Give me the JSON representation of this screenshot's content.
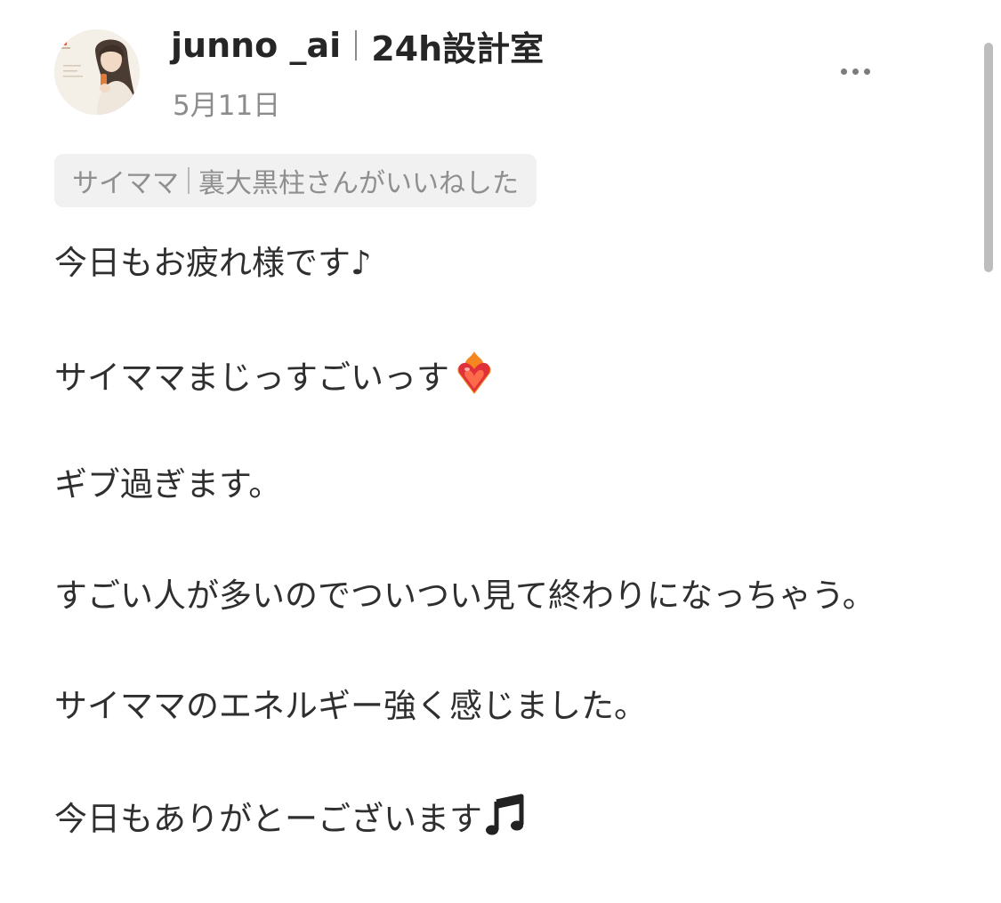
{
  "author": {
    "name": "junno _ai",
    "affiliation": "24h設計室",
    "avatar_icon": "woman-with-phone-avatar"
  },
  "post": {
    "date": "5月11日",
    "liked_by": {
      "user": "サイママ",
      "user_suffix": "裏大黒柱さん",
      "action": "がいいねした"
    },
    "lines": [
      {
        "text": "今日もお疲れ様です♪",
        "emoji": ""
      },
      {
        "text": "サイママまじっすごいっす",
        "emoji": "heart-on-fire-icon"
      },
      {
        "text": "ギブ過ぎます。",
        "emoji": ""
      },
      {
        "text": "すごい人が多いのでついつい見て終わりになっちゃう。",
        "emoji": ""
      },
      {
        "text": "サイママのエネルギー強く感じました。",
        "emoji": ""
      },
      {
        "text": "今日もありがとーございます",
        "emoji": "musical-notes-icon"
      }
    ]
  },
  "menu": {
    "icon": "more-horizontal-icon"
  },
  "colors": {
    "text_primary": "#2f2f2f",
    "text_secondary": "#8c8c8c",
    "tag_background": "#f1f1f1",
    "scrollbar": "#bdbdbd"
  }
}
